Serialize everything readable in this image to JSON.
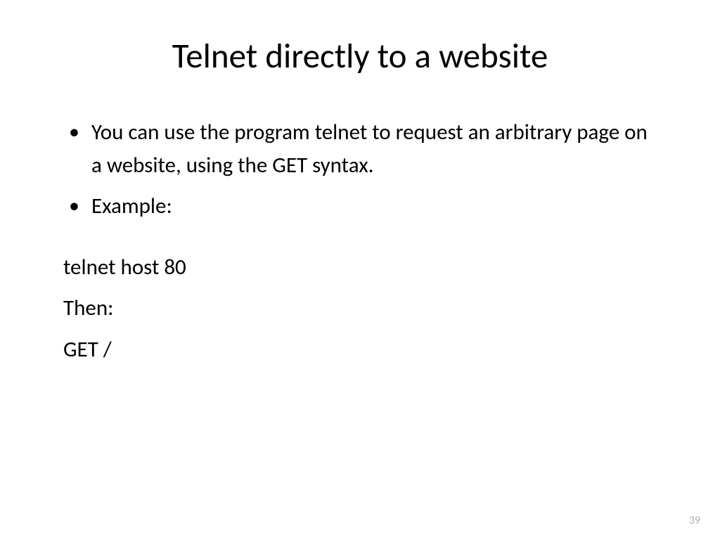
{
  "slide": {
    "title": "Telnet directly to a website",
    "bullets": [
      "You can use the program telnet to request an arbitrary page on a website, using the GET syntax.",
      "Example:"
    ],
    "body_lines": [
      "telnet host 80",
      "Then:",
      "GET /"
    ],
    "page_number": "39"
  }
}
